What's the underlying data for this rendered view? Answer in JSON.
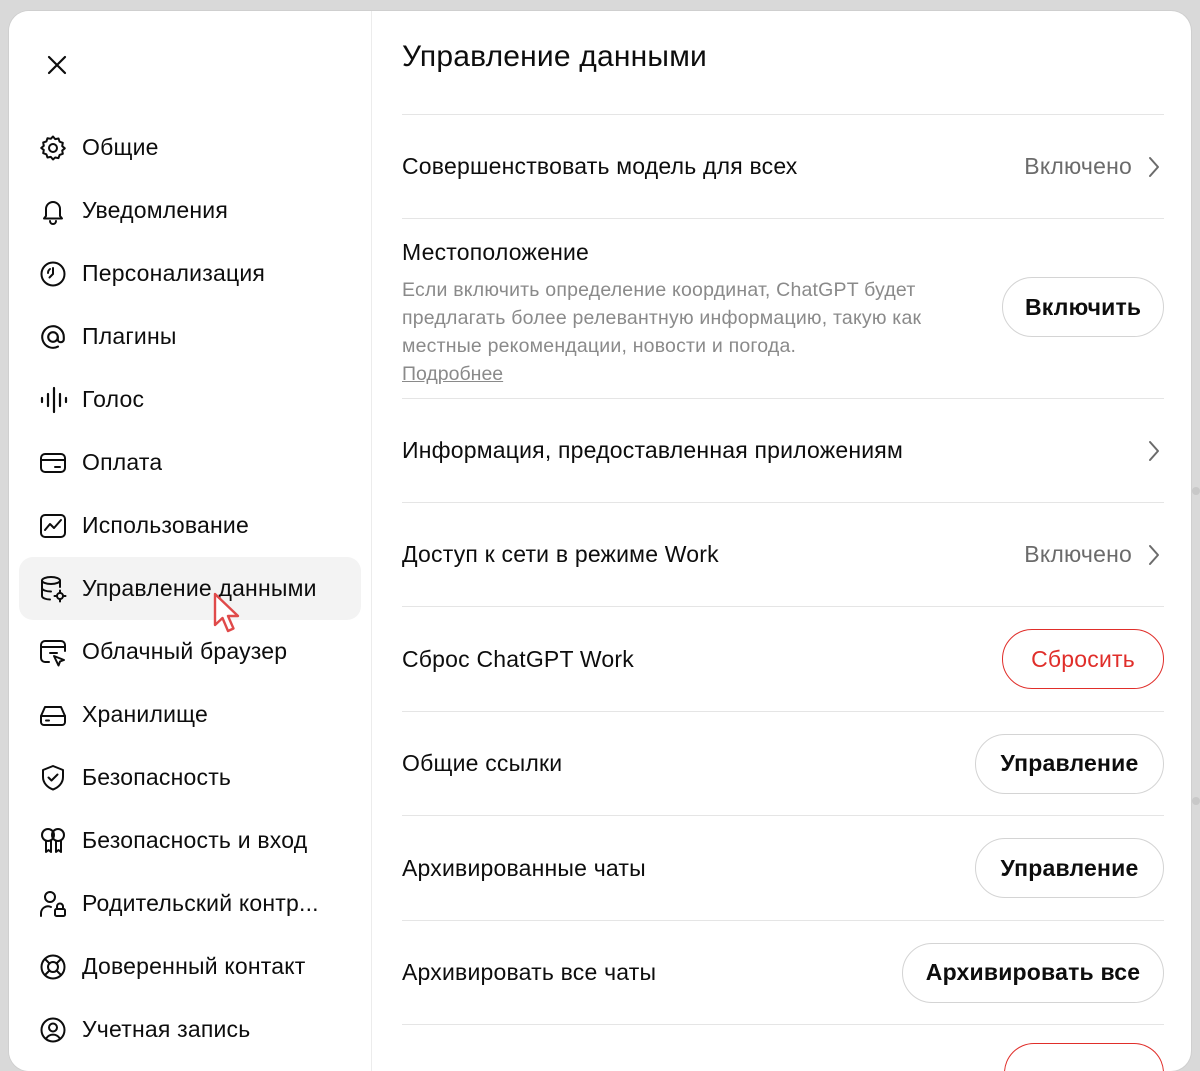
{
  "sidebar": {
    "close_icon": "close-icon",
    "items": [
      {
        "label": "Общие",
        "icon": "gear-icon"
      },
      {
        "label": "Уведомления",
        "icon": "bell-icon"
      },
      {
        "label": "Персонализация",
        "icon": "personalization-icon"
      },
      {
        "label": "Плагины",
        "icon": "at-icon"
      },
      {
        "label": "Голос",
        "icon": "waveform-icon"
      },
      {
        "label": "Оплата",
        "icon": "card-icon"
      },
      {
        "label": "Использование",
        "icon": "chart-icon"
      },
      {
        "label": "Управление данными",
        "icon": "database-gear-icon",
        "active": true
      },
      {
        "label": "Облачный браузер",
        "icon": "cloud-browser-icon"
      },
      {
        "label": "Хранилище",
        "icon": "storage-icon"
      },
      {
        "label": "Безопасность",
        "icon": "shield-check-icon"
      },
      {
        "label": "Безопасность и вход",
        "icon": "key-icon"
      },
      {
        "label": "Родительский контр...",
        "icon": "parent-lock-icon"
      },
      {
        "label": "Доверенный контакт",
        "icon": "lifebuoy-icon"
      },
      {
        "label": "Учетная запись",
        "icon": "account-icon"
      }
    ]
  },
  "main": {
    "title": "Управление данными",
    "rows": {
      "improve_model": {
        "label": "Совершенствовать модель для всех",
        "status": "Включено"
      },
      "location": {
        "title": "Местоположение",
        "description": "Если включить определение координат, ChatGPT будет предлагать более релевантную информацию, такую как местные рекомендации, новости и погода.",
        "link": "Подробнее",
        "button": "Включить"
      },
      "apps_info": {
        "label": "Информация, предоставленная приложениям"
      },
      "network_access": {
        "label": "Доступ к сети в режиме Work",
        "status": "Включено"
      },
      "reset_work": {
        "label": "Сброс ChatGPT Work",
        "button": "Сбросить"
      },
      "shared_links": {
        "label": "Общие ссылки",
        "button": "Управление"
      },
      "archived_chats": {
        "label": "Архивированные чаты",
        "button": "Управление"
      },
      "archive_all": {
        "label": "Архивировать все чаты",
        "button": "Архивировать все"
      }
    }
  },
  "colors": {
    "danger": "#e02e2a",
    "active_bg": "#f3f3f3",
    "muted": "#6b6b6b",
    "border": "#e5e5e5"
  }
}
